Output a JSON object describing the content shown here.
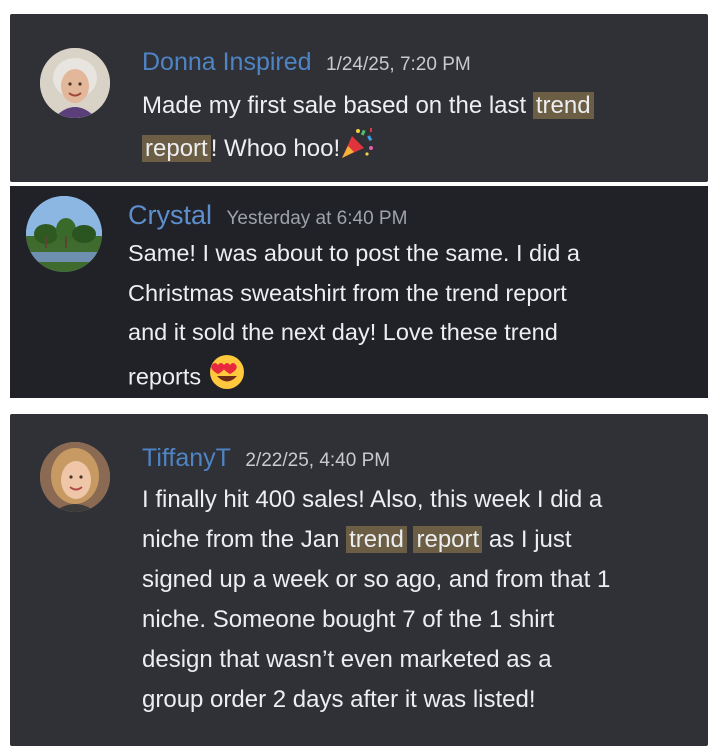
{
  "messages": [
    {
      "author": "Donna Inspired",
      "timestamp": "1/24/25, 7:20 PM",
      "text_parts": [
        "Made my first sale based on the last ",
        "trend",
        "report",
        "! Whoo hoo!"
      ],
      "emoji": "party-popper-icon"
    },
    {
      "author": "Crystal",
      "timestamp": "Yesterday at 6:40 PM",
      "lines": [
        "Same! I was about to post the same. I did a",
        "Christmas sweatshirt from the trend report",
        "and it sold the next day! Love these trend",
        "reports"
      ],
      "emoji": "heart-eyes-icon"
    },
    {
      "author": "TiffanyT",
      "timestamp": "2/22/25, 4:40 PM",
      "line1": "I finally hit 400 sales! Also, this week I did a",
      "line2_pre": "niche from the Jan ",
      "hl1": "trend",
      "hl2": "report",
      "line2_post": " as I just",
      "lines_rest": [
        "signed up a week or so ago, and from that 1",
        "niche. Someone bought 7 of the 1 shirt",
        "design that wasn’t even marketed as a",
        "group order 2 days after it was listed!"
      ]
    }
  ],
  "colors": {
    "card_bg": "#2f3136",
    "card_dark_bg": "#212228",
    "author_blue": "#4f84c4",
    "highlight": "#6b5e45",
    "text": "#eceef1"
  }
}
